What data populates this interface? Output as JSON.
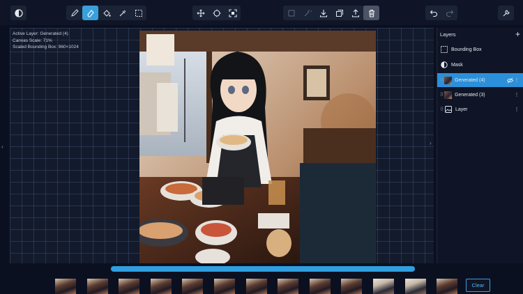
{
  "toolbar": {
    "groups": [
      {
        "name": "mode",
        "buttons": [
          "contrast-icon"
        ]
      },
      {
        "name": "tools",
        "buttons": [
          "brush-icon",
          "eraser-icon",
          "fill-icon",
          "eyedropper-icon",
          "selection-icon"
        ],
        "active": "eraser-icon"
      },
      {
        "name": "view",
        "buttons": [
          "move-icon",
          "target-icon",
          "fit-icon"
        ]
      },
      {
        "name": "actions",
        "buttons": [
          "transform-icon",
          "magic-icon",
          "download-icon",
          "copy-icon",
          "upload-icon",
          "trash-icon"
        ],
        "active": "trash-icon"
      },
      {
        "name": "history",
        "buttons": [
          "undo-icon",
          "redo-icon"
        ]
      },
      {
        "name": "settings",
        "buttons": [
          "wrench-icon"
        ]
      }
    ]
  },
  "info": {
    "active_layer": "Active Layer: Generated (4)",
    "canvas_scale": "Canvas Scale: 71%",
    "bounding_box": "Scaled Bounding Box: 960×1024"
  },
  "layers": {
    "title": "Layers",
    "items": [
      {
        "label": "Bounding Box",
        "icon": "bounding-box-icon"
      },
      {
        "label": "Mask",
        "icon": "mask-icon"
      },
      {
        "label": "Generated (4)",
        "icon": "image-thumb",
        "selected": true
      },
      {
        "label": "Generated (3)",
        "icon": "image-thumb"
      },
      {
        "label": "Layer",
        "icon": "image-icon"
      }
    ]
  },
  "progress": {
    "value": 1.0
  },
  "gallery": {
    "count": 13,
    "clear_label": "Clear"
  },
  "colors": {
    "accent": "#2b90d9",
    "background": "#0b1020",
    "panel": "#0f1526"
  }
}
